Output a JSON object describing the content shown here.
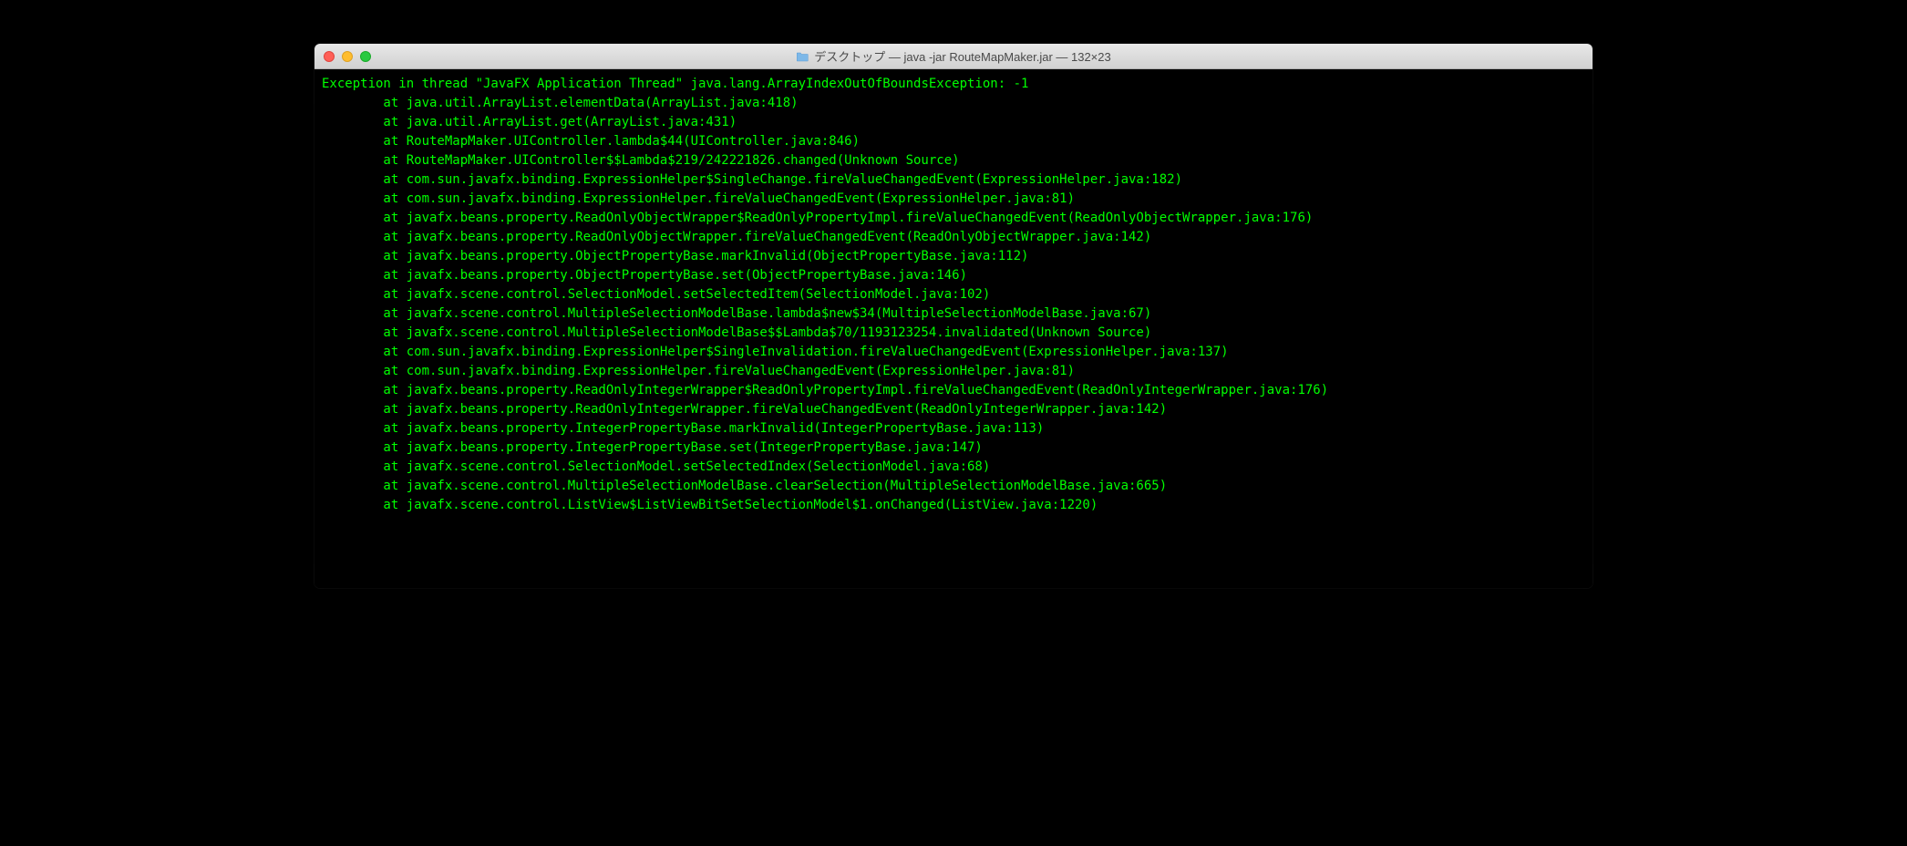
{
  "window": {
    "title": "デスクトップ — java -jar RouteMapMaker.jar — 132×23"
  },
  "terminal": {
    "exception_header": "Exception in thread \"JavaFX Application Thread\" java.lang.ArrayIndexOutOfBoundsException: -1",
    "stack": [
      "at java.util.ArrayList.elementData(ArrayList.java:418)",
      "at java.util.ArrayList.get(ArrayList.java:431)",
      "at RouteMapMaker.UIController.lambda$44(UIController.java:846)",
      "at RouteMapMaker.UIController$$Lambda$219/242221826.changed(Unknown Source)",
      "at com.sun.javafx.binding.ExpressionHelper$SingleChange.fireValueChangedEvent(ExpressionHelper.java:182)",
      "at com.sun.javafx.binding.ExpressionHelper.fireValueChangedEvent(ExpressionHelper.java:81)",
      "at javafx.beans.property.ReadOnlyObjectWrapper$ReadOnlyPropertyImpl.fireValueChangedEvent(ReadOnlyObjectWrapper.java:176)",
      "at javafx.beans.property.ReadOnlyObjectWrapper.fireValueChangedEvent(ReadOnlyObjectWrapper.java:142)",
      "at javafx.beans.property.ObjectPropertyBase.markInvalid(ObjectPropertyBase.java:112)",
      "at javafx.beans.property.ObjectPropertyBase.set(ObjectPropertyBase.java:146)",
      "at javafx.scene.control.SelectionModel.setSelectedItem(SelectionModel.java:102)",
      "at javafx.scene.control.MultipleSelectionModelBase.lambda$new$34(MultipleSelectionModelBase.java:67)",
      "at javafx.scene.control.MultipleSelectionModelBase$$Lambda$70/1193123254.invalidated(Unknown Source)",
      "at com.sun.javafx.binding.ExpressionHelper$SingleInvalidation.fireValueChangedEvent(ExpressionHelper.java:137)",
      "at com.sun.javafx.binding.ExpressionHelper.fireValueChangedEvent(ExpressionHelper.java:81)",
      "at javafx.beans.property.ReadOnlyIntegerWrapper$ReadOnlyPropertyImpl.fireValueChangedEvent(ReadOnlyIntegerWrapper.java:176)",
      "at javafx.beans.property.ReadOnlyIntegerWrapper.fireValueChangedEvent(ReadOnlyIntegerWrapper.java:142)",
      "at javafx.beans.property.IntegerPropertyBase.markInvalid(IntegerPropertyBase.java:113)",
      "at javafx.beans.property.IntegerPropertyBase.set(IntegerPropertyBase.java:147)",
      "at javafx.scene.control.SelectionModel.setSelectedIndex(SelectionModel.java:68)",
      "at javafx.scene.control.MultipleSelectionModelBase.clearSelection(MultipleSelectionModelBase.java:665)",
      "at javafx.scene.control.ListView$ListViewBitSetSelectionModel$1.onChanged(ListView.java:1220)"
    ]
  }
}
